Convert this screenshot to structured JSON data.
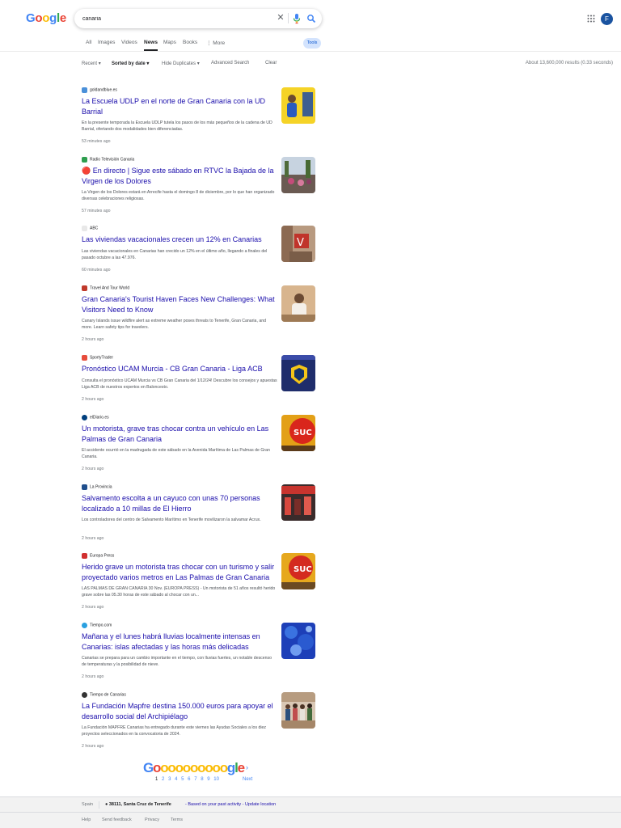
{
  "colors": {
    "link": "#1a0dab",
    "blue": "#4285f4",
    "red": "#ea4335",
    "yellow": "#fbbc05",
    "green": "#34a853"
  },
  "header": {
    "logo_letters": [
      "G",
      "o",
      "o",
      "g",
      "l",
      "e"
    ],
    "search_value": "canaria",
    "avatar_letter": "F"
  },
  "tabs": {
    "items": [
      "All",
      "Images",
      "Videos",
      "News",
      "Maps",
      "Books",
      "⋮ More"
    ],
    "active": "News",
    "tools": "Tools"
  },
  "filters": {
    "recent": "Recent",
    "sorted": "Sorted by date",
    "hide_dup": "Hide Duplicates",
    "advanced": "Advanced Search",
    "clear": "Clear",
    "results_count": "About 13,600,000 results (0.33 seconds)"
  },
  "results": [
    {
      "source": "goldandblue.es",
      "title": "La Escuela UDLP en el norte de Gran Canaria con la UD Barrial",
      "snippet": "En la presente temporada la Escuela UDLP tutela los pasos de los más pequeños de la cadena de UD Barrial, ofertando dos modalidades bien diferenciadas.",
      "time": "53 minutes ago"
    },
    {
      "source": "Radio Televisión Canaria",
      "title": "🔴 En directo | Sigue este sábado en RTVC la Bajada de la Virgen de los Dolores",
      "snippet": "La Virgen de los Dolores estará en Arrecife hasta el domingo 8 de diciembre, por lo que han organizado diversas celebraciones religiosas.",
      "time": "57 minutes ago"
    },
    {
      "source": "ABC",
      "title": "Las viviendas vacacionales crecen un 12% en Canarias",
      "snippet": "Las viviendas vacacionales en Canarias han crecido un 12% en el último año, llegando a finales del pasado octubre a las 47.976.",
      "time": "60 minutes ago"
    },
    {
      "source": "Travel And Tour World",
      "title": "Gran Canaria's Tourist Haven Faces New Challenges: What Visitors Need to Know",
      "snippet": "Canary Islands issue wildfire alert as extreme weather poses threats to Tenerife, Gran Canaria, and more. Learn safety tips for travelers.",
      "time": "2 hours ago"
    },
    {
      "source": "SportyTrader",
      "title": "Pronóstico UCAM Murcia - CB Gran Canaria - Liga ACB",
      "snippet": "Consulta el pronóstico UCAM Murcia vs CB Gran Canaria del 1/12/24! Descubre los consejos y apuestas Liga ACB de nuestros expertos en Baloncesto.",
      "time": "2 hours ago"
    },
    {
      "source": "elDiario.es",
      "title": "Un motorista, grave tras chocar contra un vehículo en Las Palmas de Gran Canaria",
      "snippet": "El accidente ocurrió en la madrugada de este sábado en la Avenida Marítima de Las Palmas de Gran Canaria.",
      "time": "2 hours ago"
    },
    {
      "source": "La Provincia",
      "title": "Salvamento escolta a un cayuco con unas 70 personas localizado a 10 millas de El Hierro",
      "snippet": "Los controladores del centro de Salvamento Marítimo en Tenerife movilizaron la salvamar Acrux.",
      "time": "2 hours ago"
    },
    {
      "source": "Europa Press",
      "title": "Herido grave un motorista tras chocar con un turismo y salir proyectado varios metros en Las Palmas de Gran Canaria",
      "snippet": "LAS PALMAS DE GRAN CANARIA 30 Nov. (EUROPA PRESS) - Un motorista de 51 años resultó herido grave sobre las 05.30 horas de este sábado al chocar con un...",
      "time": "2 hours ago"
    },
    {
      "source": "Tiempo.com",
      "title": "Mañana y el lunes habrá lluvias localmente intensas en Canarias: islas afectadas y las horas más delicadas",
      "snippet": "Canarias se prepara para un cambio importante en el tiempo, con lluvias fuertes, un notable descenso de temperaturas y la posibilidad de nieve.",
      "time": "2 hours ago"
    },
    {
      "source": "Tiempo de Canarias",
      "title": "La Fundación Mapfre destina 150.000 euros para apoyar el desarrollo social del Archipiélago",
      "snippet": "La Fundación MAPFRE Canarias ha entregado durante este viernes las Ayudas Sociales a los diez proyectos seleccionados en la convocatoria de 2024.",
      "time": "2 hours ago"
    }
  ],
  "pagination": {
    "pages": [
      "1",
      "2",
      "3",
      "4",
      "5",
      "6",
      "7",
      "8",
      "9",
      "10"
    ],
    "next": "Next"
  },
  "footer": {
    "country": "Spain",
    "location": "38111, Santa Cruz de Tenerife",
    "based_on": "- Based on your past activity - Update location",
    "links": [
      "Help",
      "Send feedback",
      "Privacy",
      "Terms"
    ]
  }
}
